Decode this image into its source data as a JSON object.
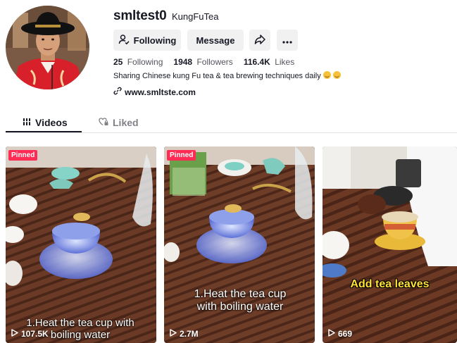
{
  "profile": {
    "username": "smltest0",
    "nickname": "KungFuTea",
    "bio": "Sharing Chinese kung Fu tea & tea brewing techniques daily",
    "link": "www.smltste.com"
  },
  "actions": {
    "following_label": "Following",
    "message_label": "Message"
  },
  "stats": {
    "following_count": "25",
    "following_label": "Following",
    "followers_count": "1948",
    "followers_label": "Followers",
    "likes_count": "116.4K",
    "likes_label": "Likes"
  },
  "tabs": [
    {
      "label": "Videos",
      "active": true
    },
    {
      "label": "Liked",
      "active": false
    }
  ],
  "videos": [
    {
      "pinned_label": "Pinned",
      "caption": "1.Heat the tea cup with boiling water",
      "views": "107.5K"
    },
    {
      "pinned_label": "Pinned",
      "caption": "1.Heat the tea cup with boiling water",
      "views": "2.7M"
    },
    {
      "caption": "Add tea leaves",
      "views": "669"
    }
  ],
  "colors": {
    "pinned_badge": "#fe2c55",
    "text_primary": "#161823",
    "button_bg": "#f1f1f2",
    "caption_yellow": "#ffe234"
  }
}
